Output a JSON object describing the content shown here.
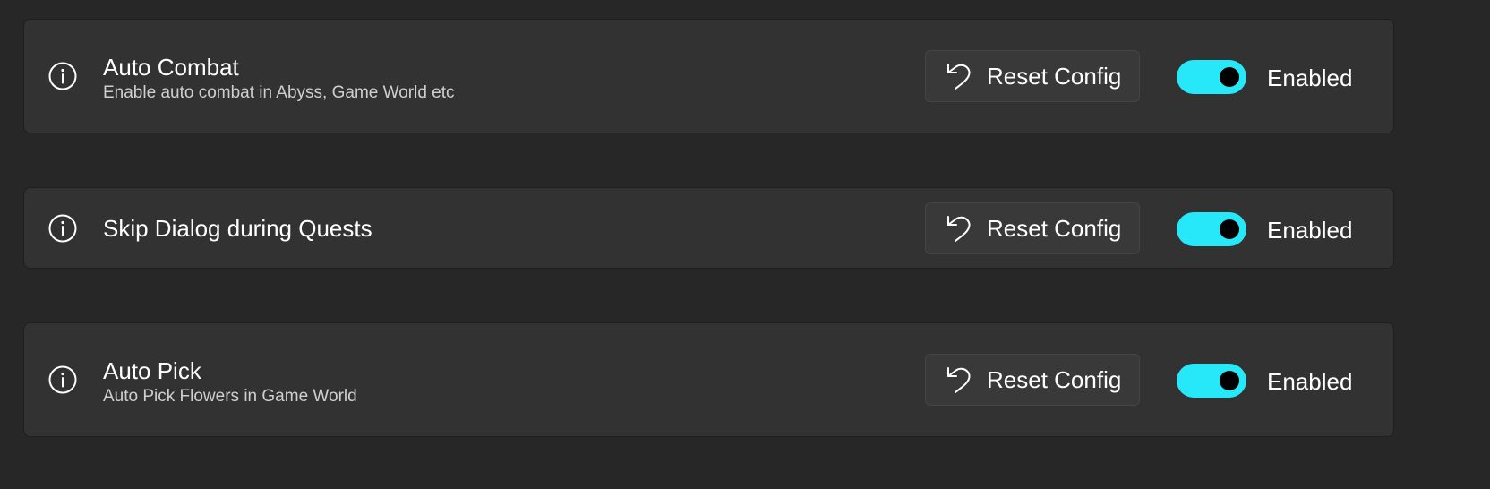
{
  "settings": [
    {
      "icon": "info-icon",
      "title": "Auto Combat",
      "description": "Enable auto combat in Abyss, Game World etc",
      "reset_label": "Reset Config",
      "reset_icon": "undo-icon",
      "toggle_on": true,
      "state_label": "Enabled"
    },
    {
      "icon": "info-icon",
      "title": "Skip Dialog during Quests",
      "reset_label": "Reset Config",
      "reset_icon": "undo-icon",
      "toggle_on": true,
      "state_label": "Enabled"
    },
    {
      "icon": "info-icon",
      "title": "Auto Pick",
      "description": "Auto Pick Flowers in Game World",
      "reset_label": "Reset Config",
      "reset_icon": "undo-icon",
      "toggle_on": true,
      "state_label": "Enabled"
    }
  ],
  "colors": {
    "background": "#272727",
    "card": "#323232",
    "accent": "#27e8f8",
    "button": "#393939"
  }
}
